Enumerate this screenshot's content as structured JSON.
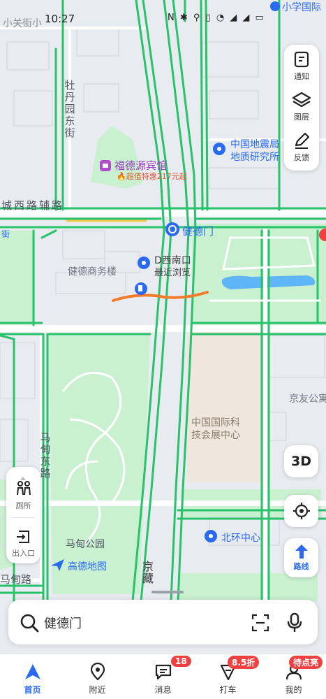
{
  "status_bar": {
    "time": "10:27",
    "icons": "N ✱ ⚲ ▯ ◔ ◢ ◢ ▭"
  },
  "map": {
    "labels": {
      "xiaoguan": "小关街小",
      "primary_school": "小学国际",
      "mudanyuan": [
        "牡",
        "丹",
        "园",
        "东",
        "街"
      ],
      "fudeyuan": "福德源宾馆",
      "fudeyuan_promo": "超值特惠217元起",
      "quake1": "中国地震局",
      "quake2": "地质研究所",
      "road_west": "城西路辅路",
      "jiandemen": "健德门",
      "jie": "街",
      "jiande_bldg": "健德商务楼",
      "d_south1": "D西南口",
      "d_south2": "最近浏览",
      "jingyou": "京友公寓",
      "expo1": "中国国际科",
      "expo2": "技会展中心",
      "madian_east": [
        "马",
        "甸",
        "东",
        "路"
      ],
      "madian_park": "马甸公园",
      "amap": "高德地图",
      "north_center": "北环中心",
      "ma_dian_road": "马甸路",
      "jingzang": [
        "京",
        "藏"
      ]
    }
  },
  "right_panel": {
    "notify": "通知",
    "layers": "图层",
    "feedback": "反馈"
  },
  "left_panel": {
    "toilet": "厕所",
    "entrance": "出入口"
  },
  "buttons": {
    "three_d": "3D",
    "route": "路线"
  },
  "search": {
    "placeholder": "健德门"
  },
  "tabs": [
    {
      "label": "首页",
      "active": true
    },
    {
      "label": "附近"
    },
    {
      "label": "消息",
      "badge": "18"
    },
    {
      "label": "打车",
      "badge": "8.5折"
    },
    {
      "label": "我的",
      "badge": "待点亮"
    }
  ],
  "colors": {
    "road_green": "#27c26a",
    "accent_blue": "#2a6af0",
    "badge_red": "#f04141",
    "traffic_orange": "#f27b2a"
  }
}
